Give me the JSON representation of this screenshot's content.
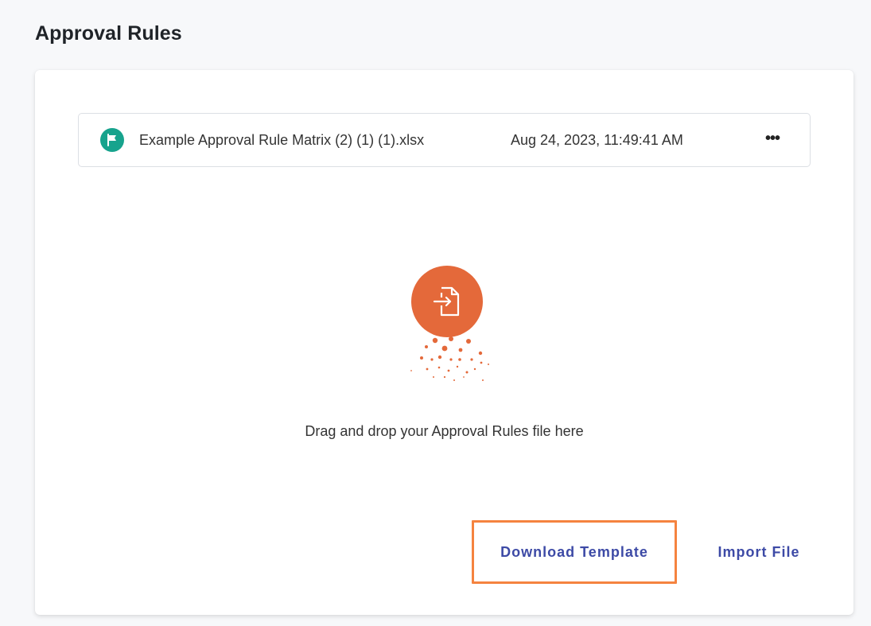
{
  "page": {
    "title": "Approval Rules"
  },
  "file": {
    "icon": "flag-icon",
    "name": "Example Approval Rule Matrix (2) (1) (1).xlsx",
    "date": "Aug 24, 2023, 11:49:41 AM",
    "menu_label": "•••",
    "menu_icon": "more-horizontal-icon"
  },
  "drop_zone": {
    "icon": "file-import-icon",
    "text": "Drag and drop your Approval Rules file here"
  },
  "actions": {
    "download_template": "Download Template",
    "import_file": "Import File"
  },
  "colors": {
    "accent_orange": "#e4693a",
    "highlight_border": "#f5833f",
    "link_blue": "#3d4aa6",
    "file_icon_teal": "#17a38d"
  }
}
